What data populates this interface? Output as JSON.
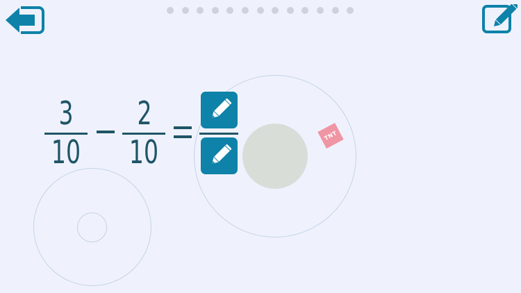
{
  "nav": {
    "back_icon": "back-arrow-icon",
    "edit_icon": "edit-pencil-icon",
    "page_dots": 13
  },
  "problem": {
    "fraction_a": {
      "numerator": "3",
      "denominator": "10"
    },
    "operator": "−",
    "fraction_b": {
      "numerator": "2",
      "denominator": "10"
    },
    "equals": "=",
    "answer_icon": "pencil-icon"
  },
  "decor": {
    "tnt_label": "TNT"
  },
  "colors": {
    "background": "#eff2fd",
    "accent": "#0e82a8",
    "text": "#1f5566",
    "tnt": "#ef95a3"
  }
}
